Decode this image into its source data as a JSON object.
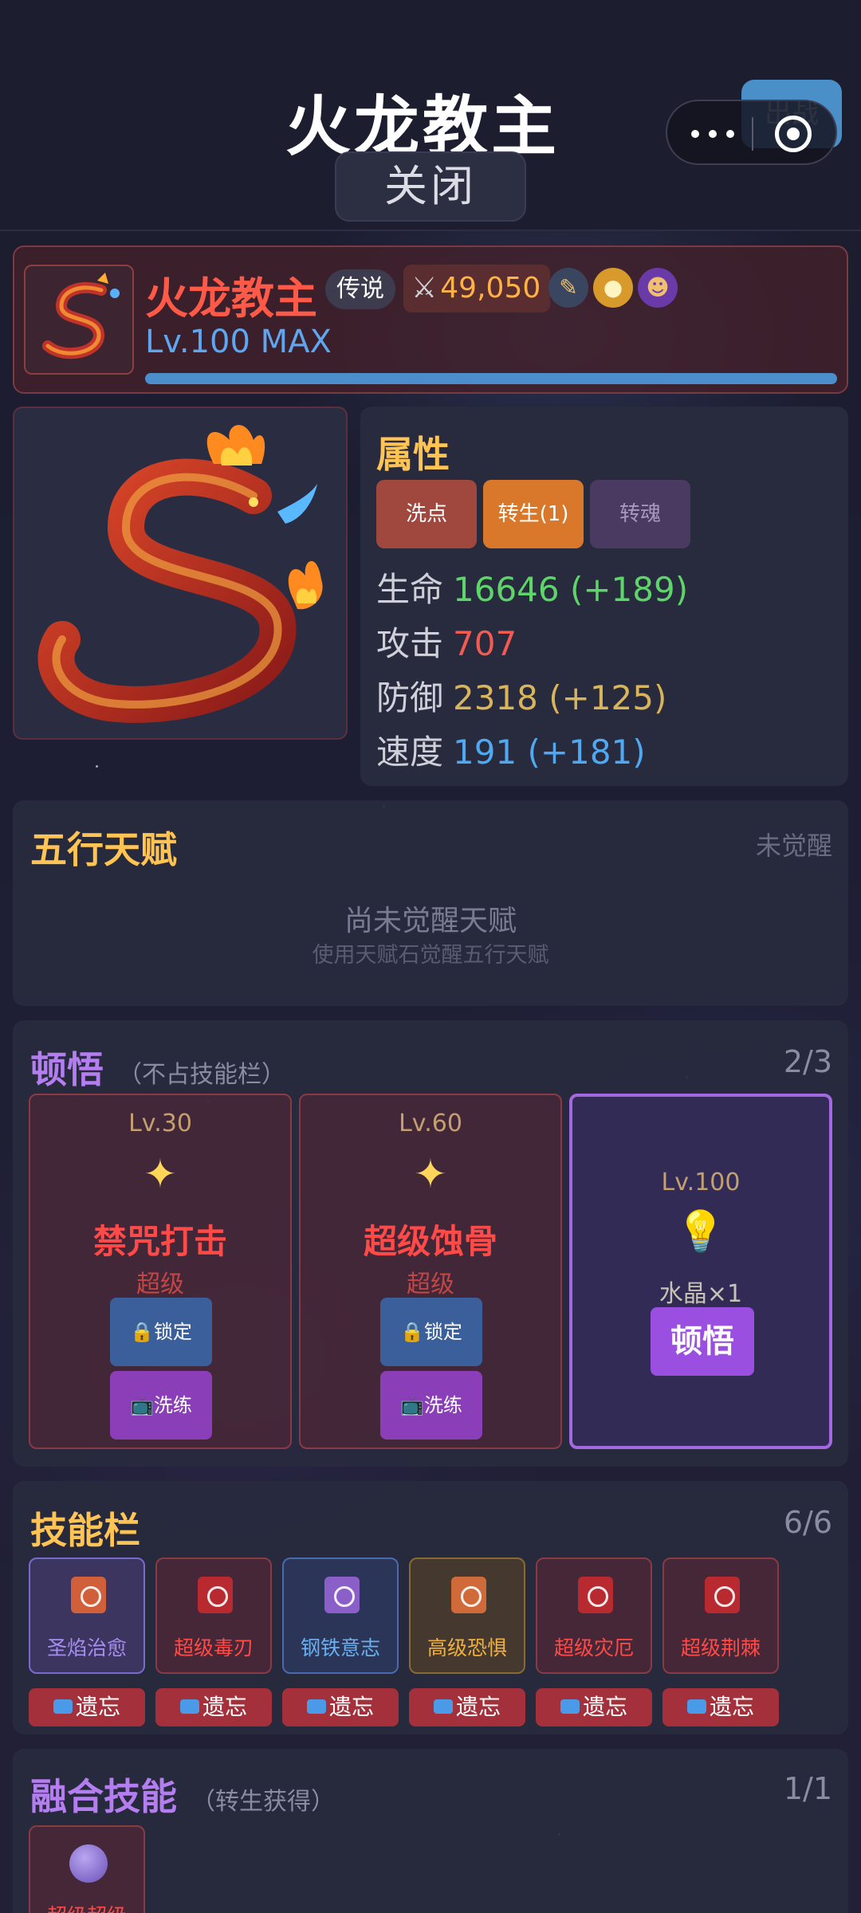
{
  "header": {
    "title": "火龙教主",
    "close_label": "关闭",
    "deploy_label": "出战"
  },
  "hero": {
    "name": "火龙教主",
    "rarity": "传说",
    "power": "49,050",
    "level": "Lv.100 MAX",
    "exp_fraction": 1.0,
    "icons": [
      "pencil-icon",
      "lock-icon",
      "character-icon"
    ]
  },
  "attributes": {
    "title": "属性",
    "buttons": [
      "洗点",
      "转生(1)",
      "转魂"
    ],
    "stats": [
      {
        "label": "生命",
        "value": "16646 (+189)",
        "color": "#5fd46a"
      },
      {
        "label": "攻击",
        "value": "707",
        "color": "#f25a52"
      },
      {
        "label": "防御",
        "value": "2318 (+125)",
        "color": "#d8b45a"
      },
      {
        "label": "速度",
        "value": "191 (+181)",
        "color": "#4fa8f0"
      }
    ]
  },
  "talent": {
    "title": "五行天赋",
    "status": "未觉醒",
    "empty_title": "尚未觉醒天赋",
    "empty_hint": "使用天赋石觉醒五行天赋"
  },
  "enlightenment": {
    "title": "顿悟",
    "subtitle": "（不占技能栏）",
    "count": "2/3",
    "cards": [
      {
        "level": "Lv.30",
        "name": "禁咒打击",
        "grade": "超级",
        "lock_label": "锁定",
        "wash_label": "洗练"
      },
      {
        "level": "Lv.60",
        "name": "超级蚀骨",
        "grade": "超级",
        "lock_label": "锁定",
        "wash_label": "洗练"
      }
    ],
    "locked_card": {
      "level": "Lv.100",
      "cost": "水晶×1",
      "button": "顿悟"
    }
  },
  "skills": {
    "title": "技能栏",
    "count": "6/6",
    "forget_label": "遗忘",
    "items": [
      {
        "name": "圣焰治愈",
        "color": "#a58ef0"
      },
      {
        "name": "超级毒刃",
        "color": "#ff4a48"
      },
      {
        "name": "钢铁意志",
        "color": "#6ab0f0"
      },
      {
        "name": "高级恐惧",
        "color": "#f0b040"
      },
      {
        "name": "超级灾厄",
        "color": "#ff4a48"
      },
      {
        "name": "超级荆棘",
        "color": "#ff4a48"
      }
    ]
  },
  "fusion": {
    "title": "融合技能",
    "subtitle": "（转生获得）",
    "count": "1/1",
    "item_name": "超级超级"
  }
}
